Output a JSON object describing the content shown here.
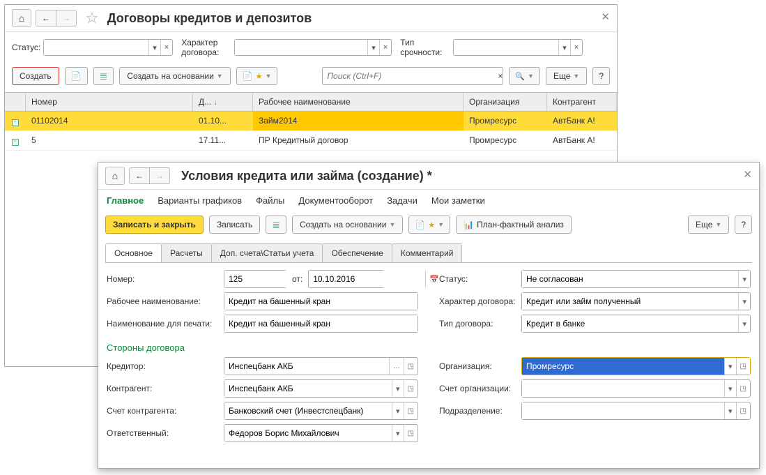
{
  "win1": {
    "title": "Договоры кредитов и депозитов",
    "filters": {
      "status_lbl": "Статус:",
      "hd_lbl": "Характер договора:",
      "type_lbl": "Тип срочности:"
    },
    "toolbar": {
      "create": "Создать",
      "base": "Создать на основании",
      "search_ph": "Поиск (Ctrl+F)",
      "more": "Еще",
      "help": "?"
    },
    "cols": {
      "num": "Номер",
      "date": "Д...",
      "workname": "Рабочее наименование",
      "org": "Организация",
      "ka": "Контрагент"
    },
    "rows": [
      {
        "num": "01102014",
        "date": "01.10...",
        "wn": "Займ2014",
        "org": "Промресурс",
        "ka": "АвтБанк А!"
      },
      {
        "num": "5",
        "date": "17.11...",
        "wn": "ПР Кредитный договор",
        "org": "Промресурс",
        "ka": "АвтБанк А!"
      }
    ]
  },
  "win2": {
    "title": "Условия кредита или займа (создание) *",
    "tabs": {
      "main": "Главное",
      "variants": "Варианты графиков",
      "files": "Файлы",
      "docflow": "Документооборот",
      "tasks": "Задачи",
      "notes": "Мои заметки"
    },
    "toolbar": {
      "save_close": "Записать и закрыть",
      "save": "Записать",
      "base": "Создать на основании",
      "plan": "План-фактный анализ",
      "more": "Еще",
      "help": "?"
    },
    "subtabs": {
      "main": "Основное",
      "calc": "Расчеты",
      "acc": "Доп. счета\\Статьи учета",
      "sec": "Обеспечение",
      "comm": "Комментарий"
    },
    "form": {
      "num_lbl": "Номер:",
      "num": "125",
      "ot_lbl": "от:",
      "date": "10.10.2016",
      "status_lbl": "Статус:",
      "status": "Не согласован",
      "wn_lbl": "Рабочее наименование:",
      "wn": "Кредит на башенный кран",
      "hd_lbl": "Характер договора:",
      "hd": "Кредит или займ полученный",
      "pn_lbl": "Наименование для печати:",
      "pn": "Кредит на башенный кран",
      "td_lbl": "Тип договора:",
      "td": "Кредит в банке",
      "section": "Стороны договора",
      "cr_lbl": "Кредитор:",
      "cr": "Инспецбанк АКБ",
      "org_lbl": "Организация:",
      "org": "Промресурс",
      "ka_lbl": "Контрагент:",
      "ka": "Инспецбанк АКБ",
      "oa_lbl": "Счет организации:",
      "oa": "",
      "kaa_lbl": "Счет контрагента:",
      "kaa": "Банковский счет (Инвестспецбанк)",
      "dep_lbl": "Подразделение:",
      "dep": "",
      "resp_lbl": "Ответственный:",
      "resp": "Федоров Борис Михайлович"
    }
  }
}
